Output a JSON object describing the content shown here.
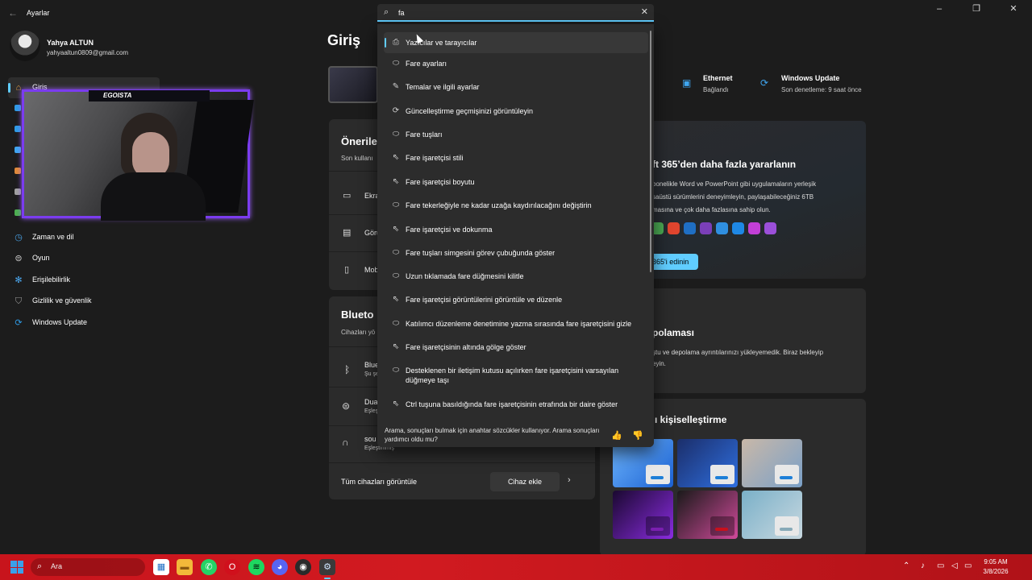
{
  "window": {
    "app_title": "Ayarlar",
    "controls": [
      "–",
      "❐",
      "✕"
    ]
  },
  "profile": {
    "name": "Yahya ALTUN",
    "email": "yahyaaltun0809@gmail.com"
  },
  "sidebar": {
    "items": [
      {
        "label": "Giriş",
        "icon": "home-icon",
        "active": true
      },
      {
        "label": "Zaman ve dil",
        "icon": "clock-globe-icon"
      },
      {
        "label": "Oyun",
        "icon": "gamepad-icon"
      },
      {
        "label": "Erişilebilirlik",
        "icon": "accessibility-icon"
      },
      {
        "label": "Gizlilik ve güvenlik",
        "icon": "shield-icon"
      },
      {
        "label": "Windows Update",
        "icon": "update-icon"
      }
    ]
  },
  "webcam": {
    "banner": "EGOISTA"
  },
  "main": {
    "page_title": "Giriş",
    "status": [
      {
        "title": "Ethernet",
        "subtitle": "Bağlandı",
        "icon": "ethernet-icon"
      },
      {
        "title": "Windows Update",
        "subtitle": "Son denetleme: 9 saat önce",
        "icon": "update-icon"
      }
    ],
    "recommended": {
      "title": "Öneriler",
      "subtitle": "Son kullanı",
      "rows": [
        {
          "label": "Ekra",
          "icon": "monitor-icon"
        },
        {
          "label": "Görü",
          "icon": "taskbar-icon"
        },
        {
          "label": "Mob",
          "icon": "phone-icon"
        }
      ]
    },
    "bluetooth": {
      "title": "Blueto",
      "subtitle": "Cihazları yö",
      "devices": [
        {
          "name": "Blue",
          "status": "Şu şe",
          "icon": "bluetooth-icon"
        },
        {
          "name": "Dua",
          "status": "Eşleş",
          "icon": "controller-icon"
        },
        {
          "name": "sou",
          "status": "Eşleştirilmiş",
          "icon": "headset-icon"
        }
      ],
      "view_all": "Tüm cihazları görüntüle",
      "add_device": "Cihaz ekle"
    },
    "microsoft365": {
      "title": "ft 365’den daha fazla yararlanın",
      "body": "bonelikle Word ve PowerPoint gibi uygulamaların yerleşik\nsaüstü sürümlerini deneyimleyin, paylaşabileceğiniz 6TB\nmasına ve çok daha fazlasına sahip olun.",
      "button": "365'i edinin",
      "app_colors": [
        "#4aa852",
        "#e0452e",
        "#1f6fc4",
        "#7b3fb8",
        "#2f8fe0",
        "#1e88e5",
        "#c23fd6",
        "#9b4fd9"
      ]
    },
    "storage": {
      "title": "polaması",
      "body": "ştu ve depolama ayrıntılarınızı yükleyemedik. Biraz bekleyip\neyin."
    },
    "personalize": {
      "title": "ı kişiselleştirme",
      "walls": [
        {
          "bg": "linear-gradient(135deg,#6fb7ff,#1a5fd0)",
          "tag": "#1e7fd8"
        },
        {
          "bg": "linear-gradient(135deg,#1b2e6a,#2f6fe0)",
          "tag": "#1e7fd8"
        },
        {
          "bg": "linear-gradient(135deg,#c9b8a8,#7aa0c8)",
          "tag": "#1e7fd8"
        },
        {
          "bg": "linear-gradient(135deg,#1a0830,#8a2ce0)",
          "tag": "#7a1fb0"
        },
        {
          "bg": "linear-gradient(135deg,#1a1a1a,#d04a9a)",
          "tag": "#c8101c"
        },
        {
          "bg": "linear-gradient(135deg,#7ab0c8,#c8d8e0)",
          "tag": "#88aab8"
        }
      ]
    }
  },
  "search": {
    "value": "fa",
    "results": [
      {
        "label": "Yazıcılar ve tarayıcılar",
        "icon": "printer-icon"
      },
      {
        "label": "Fare ayarları",
        "icon": "mouse-icon"
      },
      {
        "label": "Temalar ve ilgili ayarlar",
        "icon": "brush-icon"
      },
      {
        "label": "Güncelleştirme geçmişinizi görüntüleyin",
        "icon": "refresh-icon"
      },
      {
        "label": "Fare tuşları",
        "icon": "mouse-icon"
      },
      {
        "label": "Fare işaretçisi stili",
        "icon": "pointer-icon"
      },
      {
        "label": "Fare işaretçisi boyutu",
        "icon": "pointer-icon"
      },
      {
        "label": "Fare tekerleğiyle ne kadar uzağa kaydırılacağını değiştirin",
        "icon": "mouse-icon"
      },
      {
        "label": "Fare işaretçisi ve dokunma",
        "icon": "pointer-icon"
      },
      {
        "label": "Fare tuşları simgesini görev çubuğunda göster",
        "icon": "mouse-icon"
      },
      {
        "label": "Uzun tıklamada fare düğmesini kilitle",
        "icon": "mouse-icon"
      },
      {
        "label": "Fare işaretçisi görüntülerini görüntüle ve düzenle",
        "icon": "pointer-icon"
      },
      {
        "label": "Katılımcı düzenleme denetimine yazma sırasında fare işaretçisini gizle",
        "icon": "mouse-icon"
      },
      {
        "label": "Fare işaretçisinin altında gölge göster",
        "icon": "pointer-icon"
      },
      {
        "label": "Desteklenen bir iletişim kutusu açılırken fare işaretçisini varsayılan düğmeye taşı",
        "icon": "mouse-icon"
      },
      {
        "label": "Ctrl tuşuna basıldığında fare işaretçisinin etrafında bir daire göster",
        "icon": "pointer-icon"
      }
    ],
    "footer": "Arama, sonuçları bulmak için anahtar sözcükler kullanıyor. Arama sonuçları yardımcı oldu mu?"
  },
  "taskbar": {
    "search_label": "Ara",
    "apps": [
      {
        "name": "store",
        "bg": "#ffffff",
        "glyph": "▦",
        "color": "#1f6fc4"
      },
      {
        "name": "explorer",
        "bg": "#f2b93a",
        "glyph": "▬",
        "color": "#8a5a10"
      },
      {
        "name": "whatsapp",
        "bg": "#25d366",
        "glyph": "✆",
        "color": "#ffffff"
      },
      {
        "name": "opera",
        "bg": "#d0101c",
        "glyph": "O",
        "color": "#ffffff"
      },
      {
        "name": "spotify",
        "bg": "#1ed760",
        "glyph": "≋",
        "color": "#000000"
      },
      {
        "name": "discord",
        "bg": "#5865f2",
        "glyph": "◕",
        "color": "#ffffff"
      },
      {
        "name": "obs",
        "bg": "#2a2a2a",
        "glyph": "◉",
        "color": "#ffffff"
      },
      {
        "name": "settings",
        "bg": "#3a3a3a",
        "glyph": "⚙",
        "color": "#cfe6ff"
      }
    ],
    "time": "9:05 AM",
    "date": "3/8/2026"
  }
}
